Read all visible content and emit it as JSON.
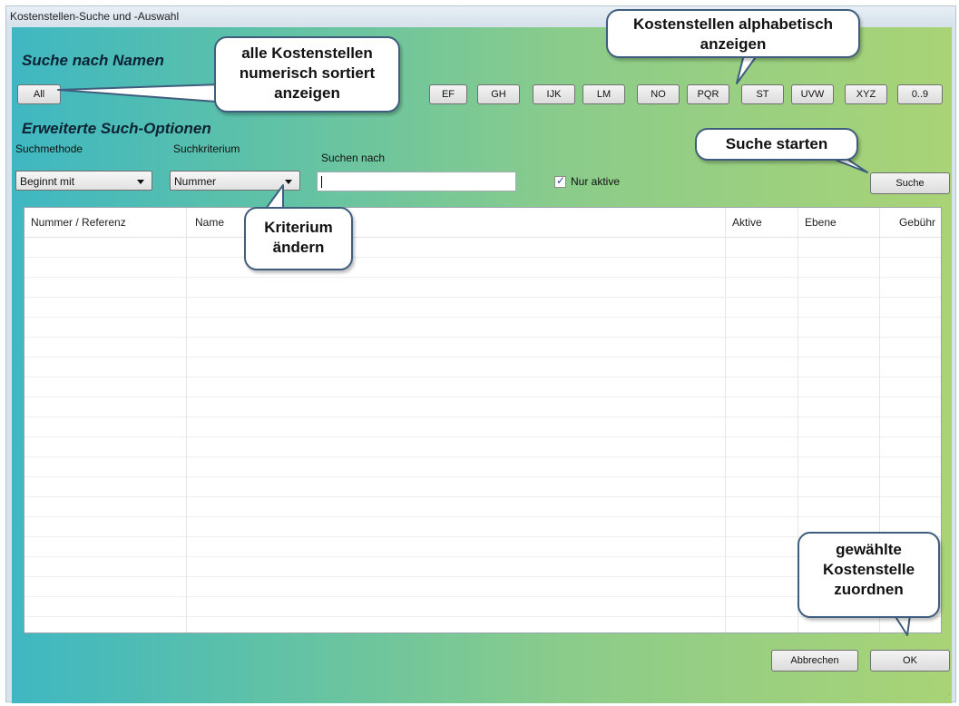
{
  "window": {
    "title": "Kostenstellen-Suche und -Auswahl"
  },
  "search_by_name": {
    "heading": "Suche nach Namen",
    "all_button": "All",
    "letter_buttons": [
      "EF",
      "GH",
      "IJK",
      "LM",
      "NO",
      "PQR",
      "ST",
      "UVW",
      "XYZ",
      "0..9"
    ]
  },
  "advanced": {
    "heading": "Erweiterte Such-Optionen",
    "method_label": "Suchmethode",
    "method_value": "Beginnt mit",
    "criterion_label": "Suchkriterium",
    "criterion_value": "Nummer",
    "search_for_label": "Suchen nach",
    "search_for_value": "",
    "only_active_label": "Nur aktive",
    "only_active_checked": true,
    "search_button": "Suche"
  },
  "table": {
    "columns": [
      "Nummer / Referenz",
      "Name",
      "Aktive",
      "Ebene",
      "Gebühr"
    ],
    "rows": []
  },
  "footer": {
    "cancel_button": "Abbrechen",
    "ok_button": "OK"
  },
  "callouts": {
    "all_numeric": "alle Kostenstellen numerisch sortiert anzeigen",
    "alphabetic": "Kostenstellen alphabetisch anzeigen",
    "start_search": "Suche starten",
    "change_criterion": "Kriterium ändern",
    "assign": "gewählte Kostenstelle zuordnen"
  },
  "colors": {
    "gradient_left": "#3fb7c2",
    "gradient_right": "#a9d376",
    "callout_border": "#3f5e7e"
  }
}
